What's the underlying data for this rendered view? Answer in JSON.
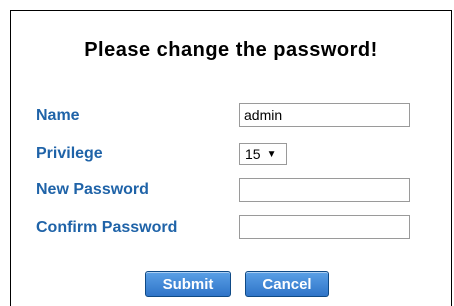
{
  "dialog": {
    "title": "Please change the password!"
  },
  "form": {
    "name_label": "Name",
    "name_value": "admin",
    "privilege_label": "Privilege",
    "privilege_value": "15",
    "new_password_label": "New Password",
    "new_password_value": "",
    "confirm_password_label": "Confirm Password",
    "confirm_password_value": ""
  },
  "buttons": {
    "submit_label": "Submit",
    "cancel_label": "Cancel"
  },
  "icons": {
    "privilege_dropdown": "chevron-down-icon"
  },
  "colors": {
    "label": "#1f63a8",
    "button": "#2f74c8"
  }
}
